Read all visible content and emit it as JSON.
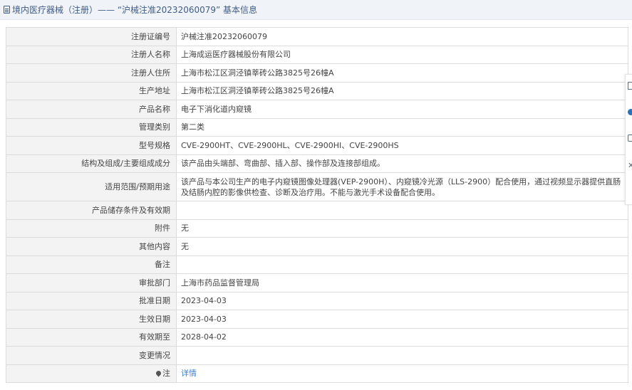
{
  "header": {
    "title": "境内医疗器械（注册）—— “沪械注准20232060079” 基本信息"
  },
  "rows": [
    {
      "label": "注册证编号",
      "value": "沪械注准20232060079"
    },
    {
      "label": "注册人名称",
      "value": "上海成运医疗器械股份有限公司"
    },
    {
      "label": "注册人住所",
      "value": "上海市松江区洞泾镇莘砖公路3825号26幢A"
    },
    {
      "label": "生产地址",
      "value": "上海市松江区洞泾镇莘砖公路3825号26幢A"
    },
    {
      "label": "产品名称",
      "value": "电子下消化道内窥镜"
    },
    {
      "label": "管理类别",
      "value": "第二类"
    },
    {
      "label": "型号规格",
      "value": "CVE-2900HT、CVE-2900HL、CVE-2900HI、CVE-2900HS"
    },
    {
      "label": "结构及组成/主要组成成分",
      "value": "该产品由头端部、弯曲部、插入部、操作部及连接部组成。"
    },
    {
      "label": "适用范围/预期用途",
      "value": "该产品与本公司生产的电子内窥镜图像处理器(VEP-2900H）、内窥镜冷光源（LLS-2900）配合使用，通过视频显示器提供直肠及结肠内腔的影像供检查、诊断及治疗用。不能与激光手术设备配合使用。"
    },
    {
      "label": "产品储存条件及有效期",
      "value": ""
    },
    {
      "label": "附件",
      "value": "无"
    },
    {
      "label": "其他内容",
      "value": "无"
    },
    {
      "label": "备注",
      "value": ""
    },
    {
      "label": "审批部门",
      "value": "上海市药品监督管理局"
    },
    {
      "label": "批准日期",
      "value": "2023-04-03"
    },
    {
      "label": "生效日期",
      "value": "2023-04-03"
    },
    {
      "label": "有效期至",
      "value": "2028-04-02"
    },
    {
      "label": "变更情况",
      "value": ""
    },
    {
      "label": "注",
      "value": "详情"
    }
  ],
  "side_toolbar": {
    "close_glyph": "✕"
  },
  "colors": {
    "header_text": "#3f5d86",
    "link": "#3b82d6",
    "label_bg": "#f3f3f3"
  }
}
